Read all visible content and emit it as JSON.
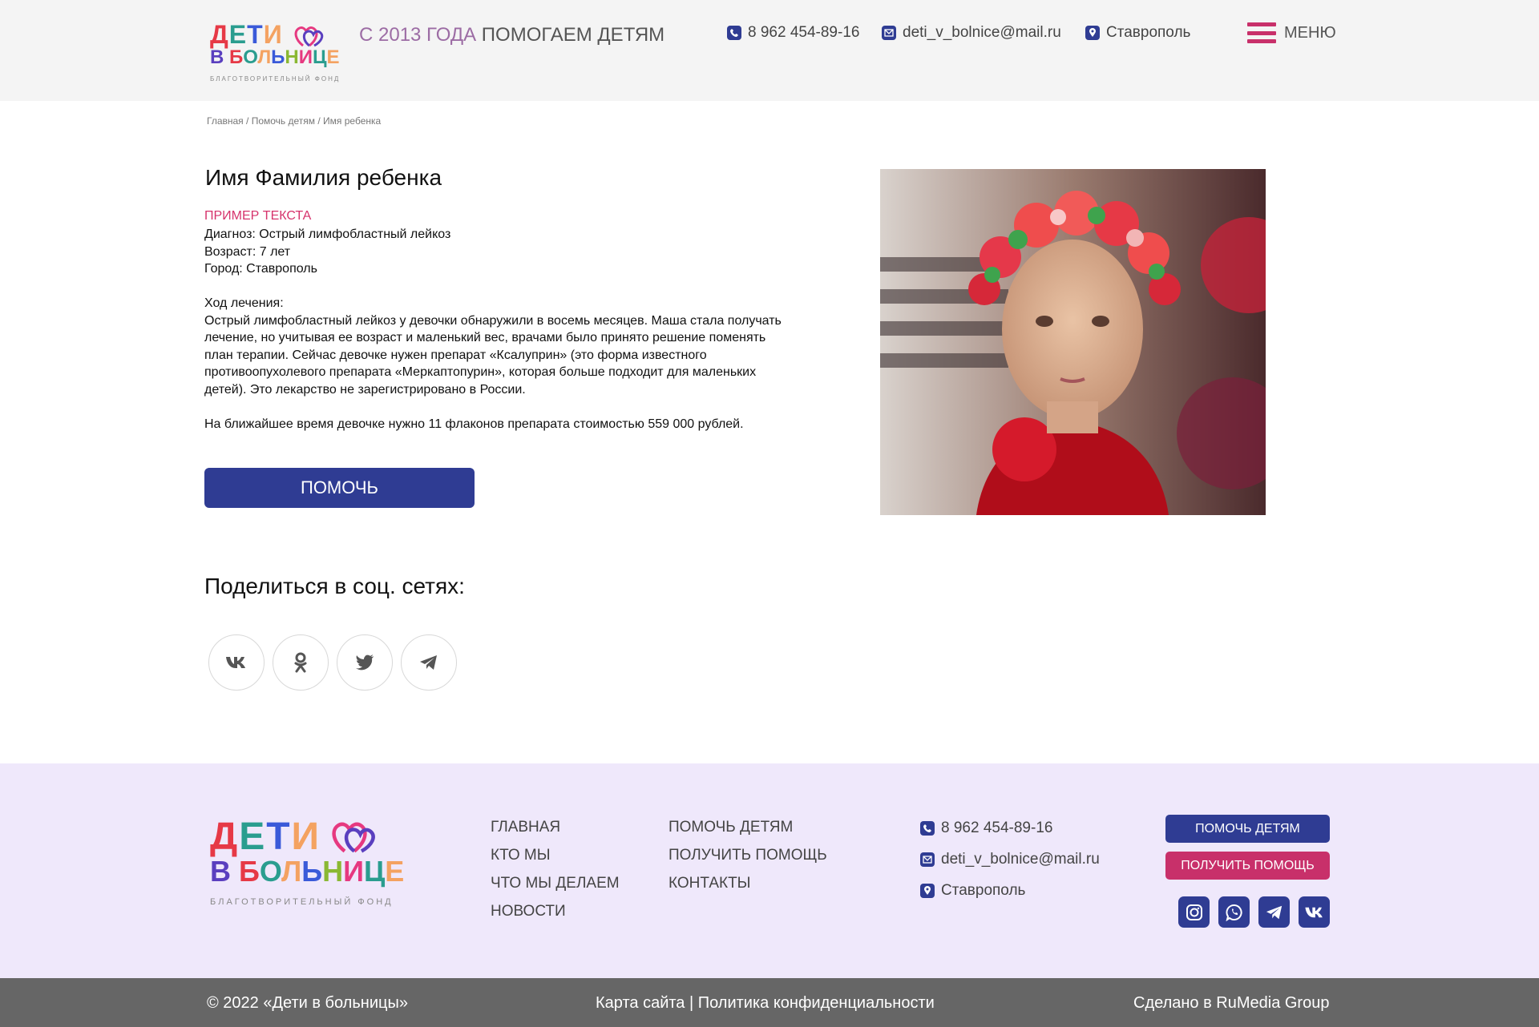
{
  "header": {
    "logo": {
      "line1": "ДЕТИ",
      "line2": "В БОЛЬНИЦЕ",
      "line3": "БЛАГОТВОРИТЕЛЬНЫЙ ФОНД"
    },
    "tagline_accent": "С 2013 ГОДА",
    "tagline_rest": "ПОМОГАЕМ ДЕТЯМ",
    "phone": "8 962 454-89-16",
    "email": "deti_v_bolnice@mail.ru",
    "city": "Ставрополь",
    "menu_label": "МЕНЮ"
  },
  "breadcrumb": {
    "home": "Главная",
    "section": "Помочь детям",
    "current": "Имя ребенка",
    "sep": " / "
  },
  "child": {
    "name": "Имя Фамилия ребенка",
    "sample_label": "ПРИМЕР ТЕКСТА",
    "diagnosis": "Диагноз: Острый лимфобластный лейкоз",
    "age": "Возраст: 7 лет",
    "city": "Город: Ставрополь",
    "treatment_heading": "Ход лечения:",
    "treatment_text": "Острый лимфобластный лейкоз у девочки обнаружили в восемь месяцев. Маша стала получать лечение, но учитывая ее возраст и маленький вес, врачами было принято решение поменять план терапии. Сейчас девочке нужен препарат «Ксалуприн» (это форма известного противоопухолевого препарата «Меркаптопурин», которая больше подходит для маленьких детей). Это лекарство не зарегистрировано в России.",
    "need_text": "На ближайшее время девочке нужно 11 флаконов препарата стоимостью 559 000 рублей.",
    "help_button": "ПОМОЧЬ"
  },
  "share": {
    "title": "Поделиться в соц. сетях:",
    "icons": [
      "vk-icon",
      "odnoklassniki-icon",
      "twitter-icon",
      "telegram-icon"
    ]
  },
  "footer": {
    "logo": {
      "line1": "ДЕТИ",
      "line2": "В БОЛЬНИЦЕ",
      "line3": "БЛАГОТВОРИТЕЛЬНЫЙ ФОНД"
    },
    "nav_col1": [
      "ГЛАВНАЯ",
      "КТО МЫ",
      "ЧТО МЫ ДЕЛАЕМ",
      "НОВОСТИ"
    ],
    "nav_col2": [
      "ПОМОЧЬ ДЕТЯМ",
      "ПОЛУЧИТЬ ПОМОЩЬ",
      "КОНТАКТЫ"
    ],
    "phone": "8 962 454-89-16",
    "email": "deti_v_bolnice@mail.ru",
    "city": "Ставрополь",
    "btn_help": "ПОМОЧЬ ДЕТЯМ",
    "btn_get_help": "ПОЛУЧИТЬ ПОМОЩЬ",
    "social_icons": [
      "instagram-icon",
      "whatsapp-icon",
      "telegram-icon",
      "vk-icon"
    ]
  },
  "bottom_bar": {
    "copyright": "© 2022 «Дети в больницы»",
    "links": "Карта сайта | Политика конфиденциальности",
    "credit": "Сделано в RuMedia Group"
  },
  "colors": {
    "brand_blue": "#2f3c93",
    "brand_pink": "#c8306a",
    "accent_purple": "#9c6ca4",
    "footer_bg": "#efe8fb",
    "bottom_bg": "#666666"
  }
}
